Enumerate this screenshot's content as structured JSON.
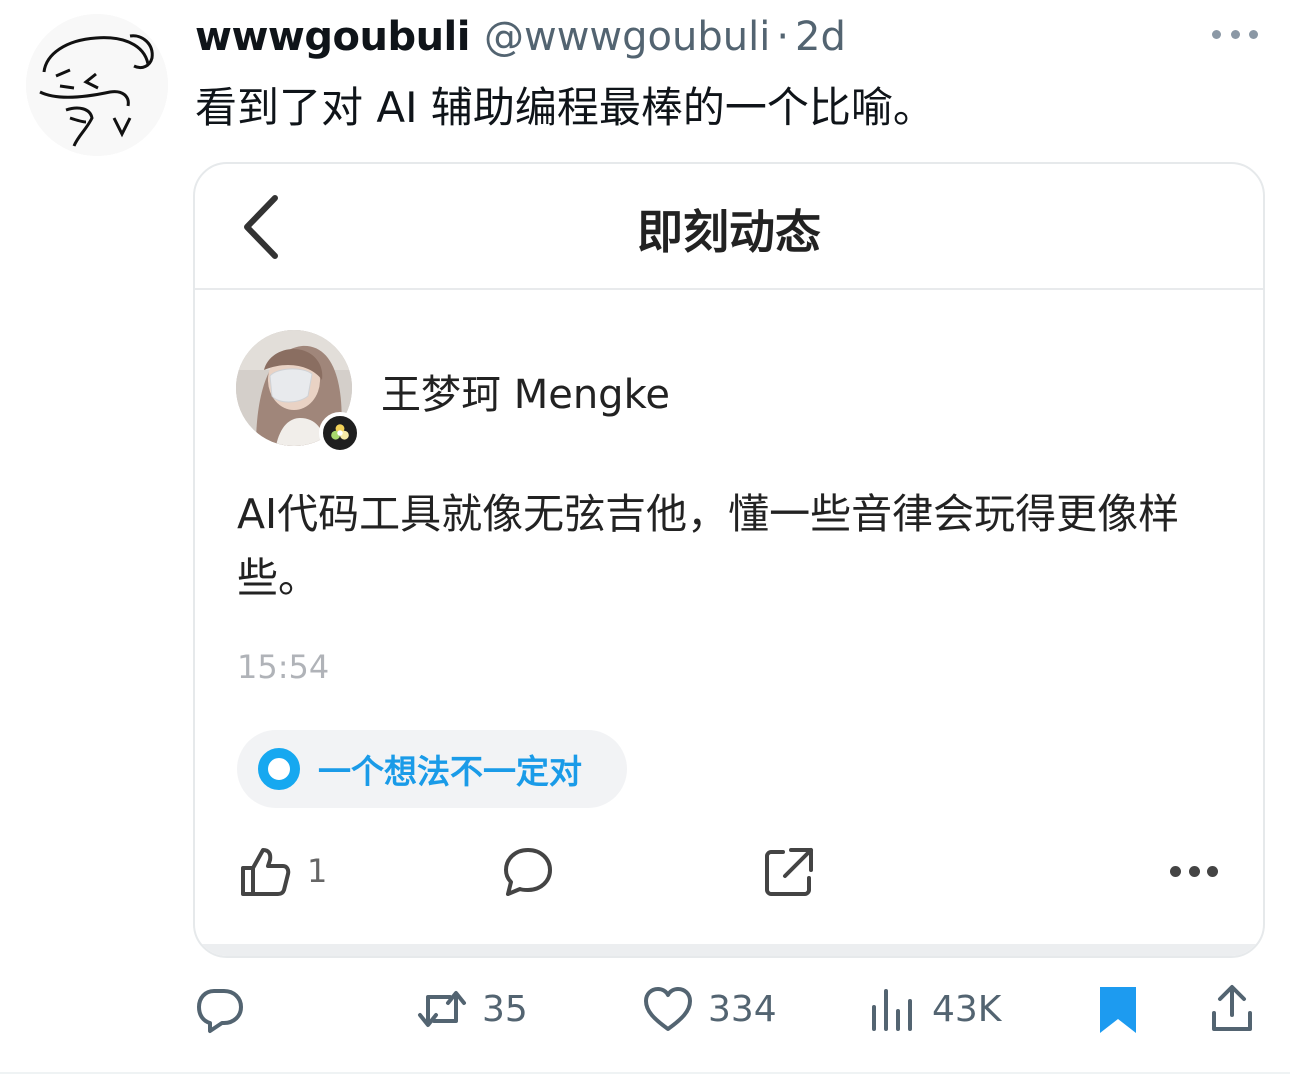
{
  "tweet": {
    "display_name": "wwwgoubuli",
    "handle": "@wwwgoubuli",
    "separator": "·",
    "time": "2d",
    "text": "看到了对 AI 辅助编程最棒的一个比喻。"
  },
  "card": {
    "title": "即刻动态",
    "user_name": "王梦珂 Mengke",
    "post_text": "AI代码工具就像无弦吉他，懂一些音律会玩得更像样些。",
    "post_time": "15:54",
    "topic": "一个想法不一定对",
    "like_count": "1",
    "accent_color": "#16a8f0"
  },
  "actions": {
    "reply_count": "",
    "retweet_count": "35",
    "like_count": "334",
    "views_count": "43K",
    "bookmark_color": "#1d9bf0"
  },
  "icons": [
    "reply-icon",
    "retweet-icon",
    "heart-icon",
    "views-icon",
    "bookmark-icon",
    "share-icon",
    "more-icon",
    "back-icon",
    "thumbs-up-icon",
    "comment-bubble-icon",
    "external-share-icon"
  ]
}
